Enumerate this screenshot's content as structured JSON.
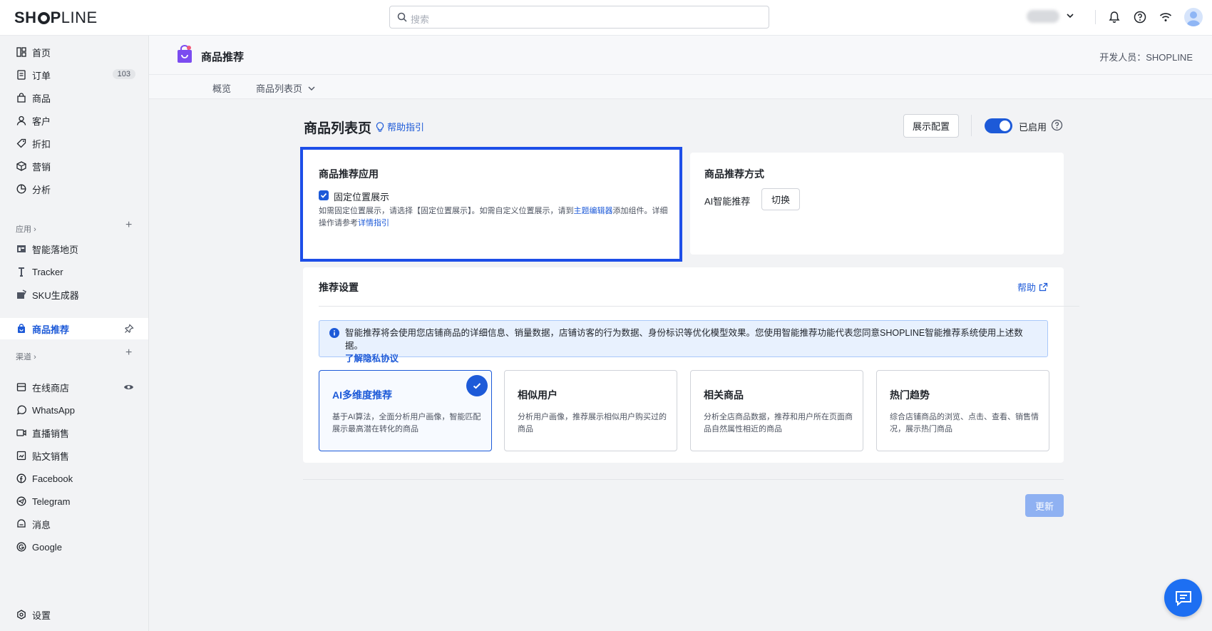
{
  "topbar": {
    "logo": "SHOPLINE",
    "search_placeholder": "搜索"
  },
  "sidebar": {
    "main_items": [
      {
        "label": "首页",
        "icon": "dashboard-icon"
      },
      {
        "label": "订单",
        "icon": "order-icon",
        "badge": "103"
      },
      {
        "label": "商品",
        "icon": "product-bag-icon"
      },
      {
        "label": "客户",
        "icon": "customer-icon"
      },
      {
        "label": "折扣",
        "icon": "discount-tag-icon"
      },
      {
        "label": "营销",
        "icon": "marketing-icon"
      },
      {
        "label": "分析",
        "icon": "analytics-icon"
      }
    ],
    "apps_section": "应用",
    "app_items": [
      {
        "label": "智能落地页",
        "icon": "landing-page-icon"
      },
      {
        "label": "Tracker",
        "icon": "tracker-icon"
      },
      {
        "label": "SKU生成器",
        "icon": "sku-icon"
      }
    ],
    "active_item": "商品推荐",
    "channels_section": "渠道",
    "channel_items": [
      {
        "label": "在线商店",
        "icon": "online-store-icon"
      },
      {
        "label": "WhatsApp",
        "icon": "whatsapp-icon"
      },
      {
        "label": "直播销售",
        "icon": "live-icon"
      },
      {
        "label": "贴文销售",
        "icon": "post-sales-icon"
      },
      {
        "label": "Facebook",
        "icon": "facebook-icon"
      },
      {
        "label": "Telegram",
        "icon": "telegram-icon"
      },
      {
        "label": "消息",
        "icon": "message-icon"
      },
      {
        "label": "Google",
        "icon": "google-icon"
      }
    ],
    "settings": "设置"
  },
  "page_header": {
    "title": "商品推荐",
    "developer": "开发人员：SHOPLINE",
    "tabs": [
      "概览",
      "商品列表页"
    ]
  },
  "content": {
    "title": "商品列表页",
    "help_guide": "帮助指引",
    "display_config": "展示配置",
    "enabled_label": "已启用",
    "app_card": {
      "title": "商品推荐应用",
      "checkbox_label": "固定位置展示",
      "desc_1": "如需固定位置展示，请选择【固定位置展示】。如需自定义位置展示，请到",
      "desc_link_1": "主题编辑器",
      "desc_2": "添加组件。详细操作请参考",
      "desc_link_2": "详情指引"
    },
    "method_card": {
      "title": "商品推荐方式",
      "method": "AI智能推荐",
      "switch_label": "切换"
    },
    "settings_card": {
      "title": "推荐设置",
      "help": "帮助",
      "info_text": "智能推荐将会使用您店铺商品的详细信息、销量数据，店铺访客的行为数据、身份标识等优化模型效果。您使用智能推荐功能代表您同意SHOPLINE智能推荐系统使用上述数据。",
      "info_link": "了解隐私协议",
      "options": [
        {
          "title": "AI多维度推荐",
          "desc": "基于AI算法，全面分析用户画像，智能匹配展示最高潜在转化的商品",
          "selected": true
        },
        {
          "title": "相似用户",
          "desc": "分析用户画像，推荐展示相似用户购买过的商品",
          "selected": false
        },
        {
          "title": "相关商品",
          "desc": "分析全店商品数据，推荐和用户所在页面商品自然属性相近的商品",
          "selected": false
        },
        {
          "title": "热门趋势",
          "desc": "综合店铺商品的浏览、点击、查看、销售情况，展示热门商品",
          "selected": false
        }
      ]
    },
    "update_button": "更新"
  },
  "colors": {
    "accent": "#1d5ad8",
    "highlight_border": "#1d4ee8",
    "banner_bg": "#e8f1fe"
  }
}
